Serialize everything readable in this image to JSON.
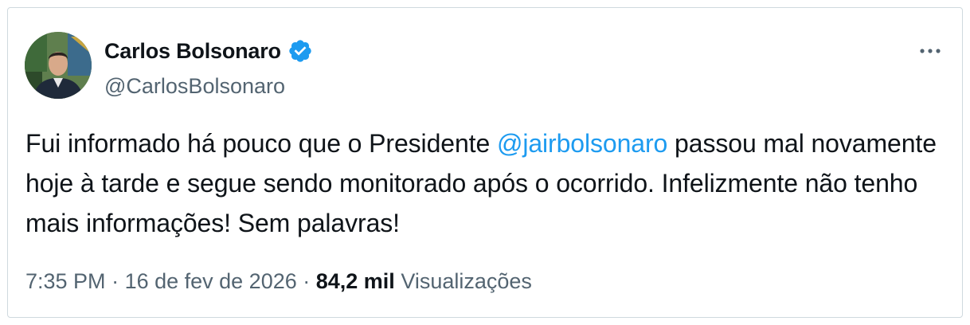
{
  "author": {
    "display_name": "Carlos Bolsonaro",
    "handle": "@CarlosBolsonaro",
    "verified": true,
    "avatar": "profile-photo"
  },
  "tweet": {
    "text_before": "Fui informado há pouco que o Presidente ",
    "mention": "@jairbolsonaro",
    "text_after": " passou mal novamente hoje à tarde e segue sendo monitorado após o ocorrido. Infelizmente não tenho mais informações! Sem palavras!"
  },
  "meta": {
    "time": "7:35 PM",
    "sep1": " · ",
    "date": "16 de fev de 2026",
    "sep2": " · ",
    "views_count": "84,2 mil",
    "views_label": " Visualizações"
  },
  "icons": {
    "verified": "verified-badge-icon",
    "more": "more-horizontal-icon"
  },
  "colors": {
    "accent": "#1d9bf0",
    "text": "#0f1419",
    "secondary": "#536471",
    "border": "#cfd9de"
  }
}
